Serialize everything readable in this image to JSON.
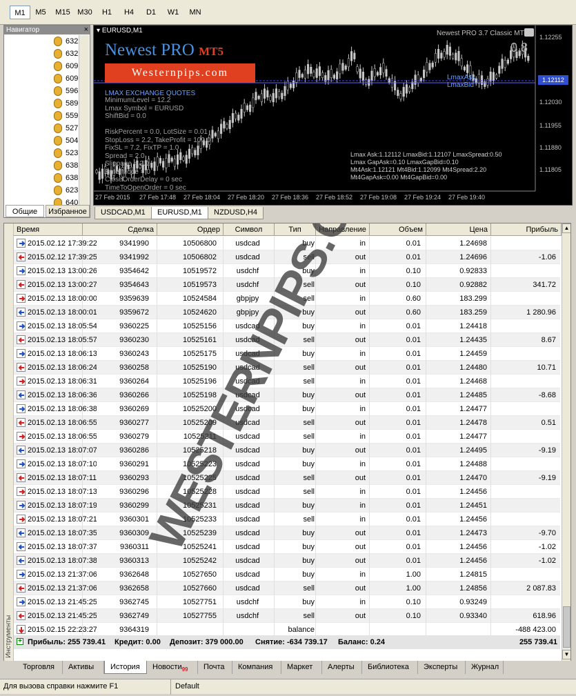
{
  "timeframes": [
    "M1",
    "M5",
    "M15",
    "M30",
    "H1",
    "H4",
    "D1",
    "W1",
    "MN"
  ],
  "navigator": {
    "title": "Навигатор",
    "close": "×",
    "items": [
      "632",
      "632",
      "609",
      "609",
      "596",
      "589",
      "559",
      "527",
      "504",
      "523",
      "638",
      "638",
      "623",
      "640"
    ],
    "tabs": [
      "Общие",
      "Избранное"
    ]
  },
  "chart": {
    "symbol_label": "EURUSD,M1",
    "indicator_name": "Newest PRO 3.7 Classic MT5",
    "spread_value": "0.8",
    "logo_main": "Newest PRO",
    "logo_sub": "MT5",
    "logo_site": "Westernpips.com",
    "quotes_title": "LMAX EXCHANGE QUOTES",
    "params": [
      "MinimumLevel = 12.2",
      "Lmax Symbol = EURUSD",
      "ShiftBid = 0.0",
      "",
      "RiskPercent = 0.0, LotSize = 0.01",
      "StopLoss = 2.2, TakeProfit = 100.0",
      "FixSL = 7.2, FixTP = 1.0",
      "Spread = 2.0",
      "Slippage = 2.0",
      "EnterMode = 0",
      "CloseOrderDelay = 0 sec",
      "TimeToOpenOrder = 0 sec"
    ],
    "stats": [
      "Lmax Ask:1.12112 LmaxBid:1.12107 LmaxSpread:0.50",
      "Lmax GapAsk=0.10 LmaxGapBid=0.10",
      "Mt4Ask:1.12121 Mt4Bid:1.12099 Mt4Spread:2.20",
      "Mt4GapAsk=0.00 Mt4GapBid=0.00"
    ],
    "lmax_ask": "LmaxAsk",
    "lmax_bid": "LmaxBid",
    "price_labels": [
      "1.12255",
      "1.12112",
      "1.12030",
      "1.11955",
      "1.11880",
      "1.11805"
    ],
    "current_price": "1.12112",
    "time_labels": [
      "27 Feb 2015",
      "27 Feb 17:48",
      "27 Feb 18:04",
      "27 Feb 18:20",
      "27 Feb 18:36",
      "27 Feb 18:52",
      "27 Feb 19:08",
      "27 Feb 19:24",
      "27 Feb 19:40"
    ],
    "tabs": [
      "USDCAD,M1",
      "EURUSD,M1",
      "NZDUSD,H4"
    ]
  },
  "table": {
    "headers": [
      "Время",
      "Сделка",
      "Ордер",
      "Символ",
      "Тип",
      "Направление",
      "Объем",
      "Цена",
      "Прибыль"
    ],
    "rows": [
      [
        "2015.02.12 17:39:22",
        "9341990",
        "10506800",
        "usdcad",
        "buy",
        "in",
        "0.01",
        "1.24698",
        ""
      ],
      [
        "2015.02.12 17:39:25",
        "9341992",
        "10506802",
        "usdcad",
        "sell",
        "out",
        "0.01",
        "1.24696",
        "-1.06"
      ],
      [
        "2015.02.13 13:00:26",
        "9354642",
        "10519572",
        "usdchf",
        "buy",
        "in",
        "0.10",
        "0.92833",
        ""
      ],
      [
        "2015.02.13 13:00:27",
        "9354643",
        "10519573",
        "usdchf",
        "sell",
        "out",
        "0.10",
        "0.92882",
        "341.72"
      ],
      [
        "2015.02.13 18:00:00",
        "9359639",
        "10524584",
        "gbpjpy",
        "sell",
        "in",
        "0.60",
        "183.299",
        ""
      ],
      [
        "2015.02.13 18:00:01",
        "9359672",
        "10524620",
        "gbpjpy",
        "buy",
        "out",
        "0.60",
        "183.259",
        "1 280.96"
      ],
      [
        "2015.02.13 18:05:54",
        "9360225",
        "10525156",
        "usdcad",
        "buy",
        "in",
        "0.01",
        "1.24418",
        ""
      ],
      [
        "2015.02.13 18:05:57",
        "9360230",
        "10525161",
        "usdcad",
        "sell",
        "out",
        "0.01",
        "1.24435",
        "8.67"
      ],
      [
        "2015.02.13 18:06:13",
        "9360243",
        "10525175",
        "usdcad",
        "buy",
        "in",
        "0.01",
        "1.24459",
        ""
      ],
      [
        "2015.02.13 18:06:24",
        "9360258",
        "10525190",
        "usdcad",
        "sell",
        "out",
        "0.01",
        "1.24480",
        "10.71"
      ],
      [
        "2015.02.13 18:06:31",
        "9360264",
        "10525196",
        "usdcad",
        "sell",
        "in",
        "0.01",
        "1.24468",
        ""
      ],
      [
        "2015.02.13 18:06:36",
        "9360266",
        "10525198",
        "usdcad",
        "buy",
        "out",
        "0.01",
        "1.24485",
        "-8.68"
      ],
      [
        "2015.02.13 18:06:38",
        "9360269",
        "10525200",
        "usdcad",
        "buy",
        "in",
        "0.01",
        "1.24477",
        ""
      ],
      [
        "2015.02.13 18:06:55",
        "9360277",
        "10525209",
        "usdcad",
        "sell",
        "out",
        "0.01",
        "1.24478",
        "0.51"
      ],
      [
        "2015.02.13 18:06:55",
        "9360279",
        "10525211",
        "usdcad",
        "sell",
        "in",
        "0.01",
        "1.24477",
        ""
      ],
      [
        "2015.02.13 18:07:07",
        "9360286",
        "10525218",
        "usdcad",
        "buy",
        "out",
        "0.01",
        "1.24495",
        "-9.19"
      ],
      [
        "2015.02.13 18:07:10",
        "9360291",
        "10525223",
        "usdcad",
        "buy",
        "in",
        "0.01",
        "1.24488",
        ""
      ],
      [
        "2015.02.13 18:07:11",
        "9360293",
        "10525225",
        "usdcad",
        "sell",
        "out",
        "0.01",
        "1.24470",
        "-9.19"
      ],
      [
        "2015.02.13 18:07:13",
        "9360296",
        "10525228",
        "usdcad",
        "sell",
        "in",
        "0.01",
        "1.24456",
        ""
      ],
      [
        "2015.02.13 18:07:19",
        "9360299",
        "10525231",
        "usdcad",
        "buy",
        "in",
        "0.01",
        "1.24451",
        ""
      ],
      [
        "2015.02.13 18:07:21",
        "9360301",
        "10525233",
        "usdcad",
        "sell",
        "in",
        "0.01",
        "1.24456",
        ""
      ],
      [
        "2015.02.13 18:07:35",
        "9360309",
        "10525239",
        "usdcad",
        "buy",
        "out",
        "0.01",
        "1.24473",
        "-9.70"
      ],
      [
        "2015.02.13 18:07:37",
        "9360311",
        "10525241",
        "usdcad",
        "buy",
        "out",
        "0.01",
        "1.24456",
        "-1.02"
      ],
      [
        "2015.02.13 18:07:38",
        "9360313",
        "10525242",
        "usdcad",
        "buy",
        "out",
        "0.01",
        "1.24456",
        "-1.02"
      ],
      [
        "2015.02.13 21:37:06",
        "9362648",
        "10527650",
        "usdcad",
        "buy",
        "in",
        "1.00",
        "1.24815",
        ""
      ],
      [
        "2015.02.13 21:37:06",
        "9362658",
        "10527660",
        "usdcad",
        "sell",
        "out",
        "1.00",
        "1.24856",
        "2 087.83"
      ],
      [
        "2015.02.13 21:45:25",
        "9362745",
        "10527751",
        "usdchf",
        "buy",
        "in",
        "0.10",
        "0.93249",
        ""
      ],
      [
        "2015.02.13 21:45:25",
        "9362749",
        "10527755",
        "usdchf",
        "sell",
        "out",
        "0.10",
        "0.93340",
        "618.96"
      ],
      [
        "2015.02.15 22:23:27",
        "9364319",
        "",
        "",
        "balance",
        "",
        "",
        "",
        "-488 423.00"
      ]
    ],
    "totals": {
      "profit": "Прибыль: 255 739.41",
      "credit": "Кредит: 0.00",
      "deposit": "Депозит: 379 000.00",
      "withdrawal": "Снятие: -634 739.17",
      "balance": "Баланс: 0.24",
      "total_profit": "255 739.41"
    },
    "side_label": "Инструменты",
    "watermark": "WESTERNPIPS.COM"
  },
  "bottom_tabs": [
    "Торговля",
    "Активы",
    "История",
    "Новости",
    "Почта",
    "Компания",
    "Маркет",
    "Алерты",
    "Библиотека",
    "Эксперты",
    "Журнал"
  ],
  "news_badge": "99",
  "status": {
    "help": "Для вызова справки нажмите F1",
    "profile": "Default"
  }
}
